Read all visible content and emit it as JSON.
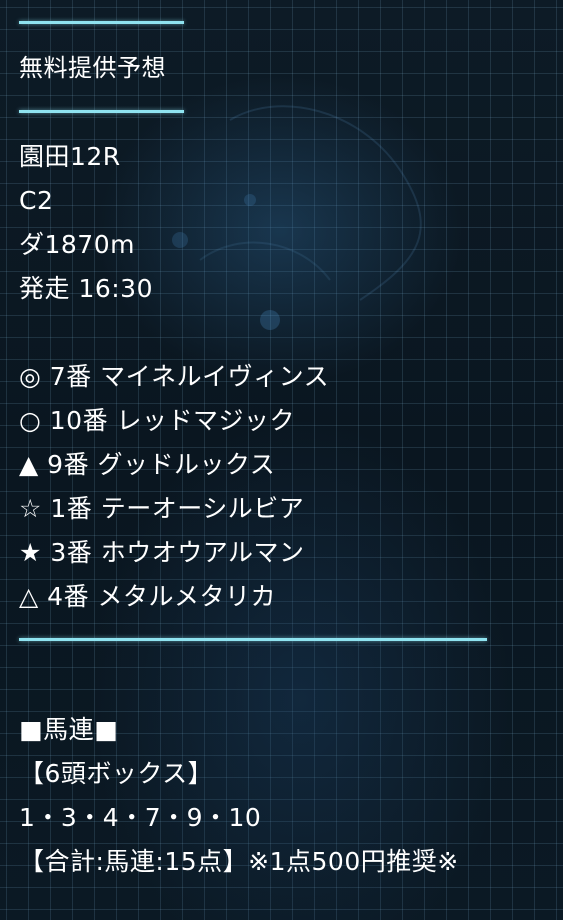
{
  "header": {
    "title": "無料提供予想"
  },
  "race": {
    "venue": "園田12R",
    "class": "C2",
    "distance": "ダ1870m",
    "start_time": "発走 16:30"
  },
  "picks": [
    "◎ 7番 マイネルイヴィンス",
    "○ 10番 レッドマジック",
    "▲ 9番 グッドルックス",
    "☆ 1番 テーオーシルビア",
    "★ 3番 ホウオウアルマン",
    "△ 4番 メタルメタリカ"
  ],
  "bet": {
    "type": "■馬連■",
    "format": "【6頭ボックス】",
    "numbers": "1・3・4・7・9・10",
    "summary": "【合計:馬連:15点】※1点500円推奨※"
  },
  "colors": {
    "accent_line": "#8fe3f0",
    "text": "#ffffff",
    "background": "#0b1822"
  }
}
